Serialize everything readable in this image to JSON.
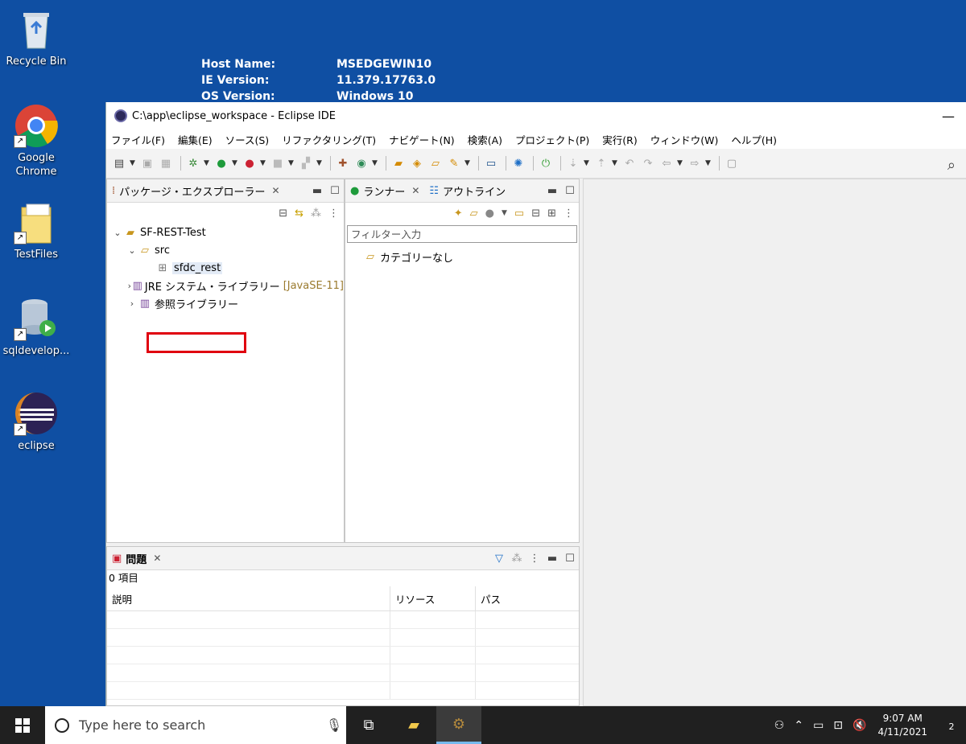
{
  "desktop": {
    "icons": [
      {
        "label": "Recycle Bin"
      },
      {
        "label": "Google Chrome"
      },
      {
        "label": "TestFiles"
      },
      {
        "label": "sqldevelop..."
      },
      {
        "label": "eclipse"
      }
    ],
    "bginfo": [
      {
        "key": "Host Name:",
        "value": "MSEDGEWIN10"
      },
      {
        "key": "IE Version:",
        "value": "11.379.17763.0"
      },
      {
        "key": "OS Version:",
        "value": "Windows 10"
      }
    ]
  },
  "window": {
    "title": "C:\\app\\eclipse_workspace - Eclipse IDE",
    "minimize": "—"
  },
  "menu": [
    "ファイル(F)",
    "編集(E)",
    "ソース(S)",
    "リファクタリング(T)",
    "ナビゲート(N)",
    "検索(A)",
    "プロジェクト(P)",
    "実行(R)",
    "ウィンドウ(W)",
    "ヘルプ(H)"
  ],
  "package_explorer": {
    "tab": "パッケージ・エクスプローラー",
    "project": "SF-REST-Test",
    "src": "src",
    "package": "sfdc_rest",
    "jre": "JRE システム・ライブラリー",
    "jre_deco": "[JavaSE-11]",
    "ref_lib": "参照ライブラリー"
  },
  "runner": {
    "tab": "ランナー",
    "outline_tab": "アウトライン",
    "filter_placeholder": "フィルター入力",
    "category": "カテゴリーなし"
  },
  "problems": {
    "tab": "問題",
    "count": "0 項目",
    "columns": [
      "説明",
      "リソース",
      "パス"
    ]
  },
  "taskbar": {
    "search_placeholder": "Type here to search",
    "time": "9:07 AM",
    "date": "4/11/2021",
    "notification_count": "2"
  }
}
